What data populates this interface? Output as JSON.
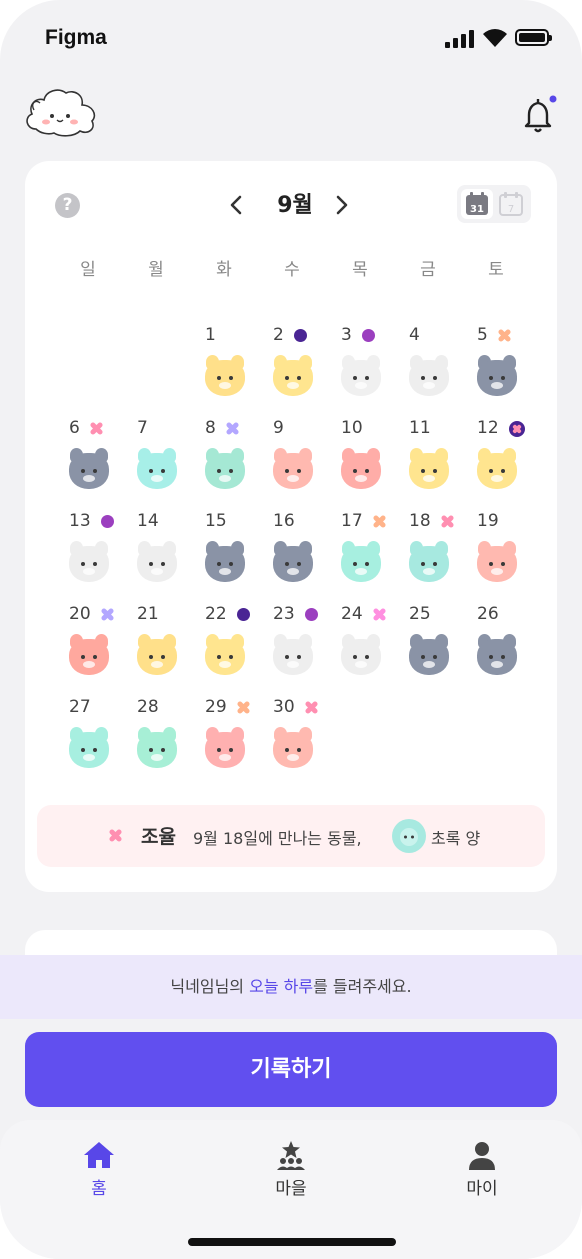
{
  "status_bar": {
    "carrier": "Figma"
  },
  "header": {
    "logo_icon": "cloud-mascot-icon",
    "bell_icon": "bell-icon",
    "has_notification": true
  },
  "calendar": {
    "help_icon_label": "?",
    "month_label": "9월",
    "weekdays": [
      "일",
      "월",
      "화",
      "수",
      "목",
      "금",
      "토"
    ],
    "days": [
      {
        "d": "1",
        "marker": "",
        "animal": "tiger",
        "color": "#ffe08a"
      },
      {
        "d": "2",
        "marker": "dot",
        "marker_color": "#4a2594",
        "animal": "rabbit",
        "color": "#ffe58f"
      },
      {
        "d": "3",
        "marker": "dot",
        "marker_color": "#9b3fbf",
        "animal": "dragon",
        "color": "#f0f0f0"
      },
      {
        "d": "4",
        "marker": "",
        "animal": "snake",
        "color": "#eeeeee"
      },
      {
        "d": "5",
        "marker": "x",
        "marker_color": "#ffb38a",
        "animal": "horse",
        "color": "#8a93a6"
      },
      {
        "d": "6",
        "marker": "x",
        "marker_color": "#ff8fb1",
        "animal": "sheep",
        "color": "#8a93a6"
      },
      {
        "d": "7",
        "marker": "",
        "animal": "monkey",
        "color": "#a7efe8"
      },
      {
        "d": "8",
        "marker": "x",
        "marker_color": "#b3a7ff",
        "animal": "rooster",
        "color": "#a5e8d4"
      },
      {
        "d": "9",
        "marker": "",
        "animal": "dog",
        "color": "#ffb9b0"
      },
      {
        "d": "10",
        "marker": "",
        "animal": "pig",
        "color": "#ffada8"
      },
      {
        "d": "11",
        "marker": "",
        "animal": "mouse",
        "color": "#ffe58f"
      },
      {
        "d": "12",
        "marker": "xcircle",
        "animal": "ox",
        "color": "#ffe58f"
      },
      {
        "d": "13",
        "marker": "dot",
        "marker_color": "#9b3fbf",
        "animal": "tiger",
        "color": "#eeeeee"
      },
      {
        "d": "14",
        "marker": "",
        "animal": "rabbit",
        "color": "#eeeeee"
      },
      {
        "d": "15",
        "marker": "",
        "animal": "dragon",
        "color": "#8a93a6"
      },
      {
        "d": "16",
        "marker": "",
        "animal": "snake",
        "color": "#8a93a6"
      },
      {
        "d": "17",
        "marker": "x",
        "marker_color": "#ffb38a",
        "animal": "horse",
        "color": "#a7efe0"
      },
      {
        "d": "18",
        "marker": "x",
        "marker_color": "#ff8fb1",
        "animal": "sheep",
        "color": "#a7e9e0"
      },
      {
        "d": "19",
        "marker": "",
        "animal": "monkey",
        "color": "#ffb9b0"
      },
      {
        "d": "20",
        "marker": "x",
        "marker_color": "#b3a7ff",
        "animal": "rooster",
        "color": "#ffa89e"
      },
      {
        "d": "21",
        "marker": "",
        "animal": "dog",
        "color": "#ffe08a"
      },
      {
        "d": "22",
        "marker": "dot",
        "marker_color": "#4a2594",
        "animal": "pig",
        "color": "#ffe58f"
      },
      {
        "d": "23",
        "marker": "dot",
        "marker_color": "#9b3fbf",
        "animal": "mouse",
        "color": "#eeeeee"
      },
      {
        "d": "24",
        "marker": "x",
        "marker_color": "#ff8fe0",
        "animal": "ox",
        "color": "#eeeeee"
      },
      {
        "d": "25",
        "marker": "",
        "animal": "tiger",
        "color": "#8a93a6"
      },
      {
        "d": "26",
        "marker": "",
        "animal": "rabbit",
        "color": "#8a93a6"
      },
      {
        "d": "27",
        "marker": "",
        "animal": "dragon",
        "color": "#a7efe0"
      },
      {
        "d": "28",
        "marker": "",
        "animal": "snake",
        "color": "#a7efd6"
      },
      {
        "d": "29",
        "marker": "x",
        "marker_color": "#ffb38a",
        "animal": "horse",
        "color": "#ffb0b0"
      },
      {
        "d": "30",
        "marker": "x",
        "marker_color": "#ff8fb1",
        "animal": "sheep",
        "color": "#ffb9b0"
      }
    ],
    "info": {
      "marker_icon": "pink-cross-icon",
      "title": "조율",
      "text": "9월 18일에 만나는 동물,",
      "animal_icon": "green-sheep-icon",
      "animal_name": "초록 양"
    }
  },
  "banner": {
    "prefix": "닉네임님의 ",
    "highlight": "오늘 하루",
    "suffix": "를 들려주세요."
  },
  "record_button": "기록하기",
  "tabs": [
    {
      "label": "홈",
      "icon": "home-icon",
      "active": true
    },
    {
      "label": "마을",
      "icon": "village-icon",
      "active": false
    },
    {
      "label": "마이",
      "icon": "person-icon",
      "active": false
    }
  ],
  "colors": {
    "accent": "#614fef",
    "accent_text": "#5847e8",
    "background": "#f2f2f4"
  }
}
